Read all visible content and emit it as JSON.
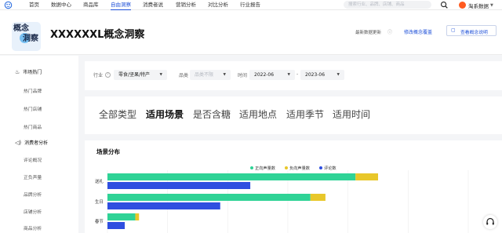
{
  "nav": {
    "items": [
      {
        "label": "首页",
        "active": false
      },
      {
        "label": "数据中心",
        "active": false
      },
      {
        "label": "商品库",
        "active": false
      },
      {
        "label": "自由洞察",
        "active": true
      },
      {
        "label": "消费者说",
        "active": false
      },
      {
        "label": "营销分析",
        "active": false
      },
      {
        "label": "对比分析",
        "active": false
      },
      {
        "label": "行业报告",
        "active": false
      }
    ],
    "search_placeholder": "搜索行业、品牌、店铺、商品",
    "brand": "淘系数据"
  },
  "header": {
    "logo_line1": "概念",
    "logo_line2": "洞察",
    "title": "XXXXXXL概念洞察",
    "update_label": "最新数据更新",
    "modify_label": "修改概念覆盖",
    "view_label": "查看概念说明"
  },
  "sidebar": {
    "sections": [
      {
        "title": "市场热门",
        "icon": "fire-icon",
        "items": [
          "热门品牌",
          "热门店铺",
          "热门商品"
        ]
      },
      {
        "title": "消费者分析",
        "icon": "speaker-icon",
        "items": [
          "评论概况",
          "正负声量",
          "品牌分析",
          "店铺分析",
          "商品分析"
        ]
      }
    ]
  },
  "filters": {
    "industry_label": "行业",
    "industry_value": "零食/坚果/特产",
    "category_label": "品类",
    "category_placeholder": "品类不限",
    "time_label": "时间",
    "time_start": "2022-06",
    "time_sep": "-",
    "time_end": "2023-06"
  },
  "tabs": [
    "全部类型",
    "适用场景",
    "是否含糖",
    "适用地点",
    "适用季节",
    "适用时间"
  ],
  "active_tab": "适用场景",
  "colors": {
    "positive": "#2fd396",
    "negative": "#e8c72a",
    "reviews": "#2f4fe0",
    "accent": "#1d4fd8"
  },
  "chart_data": {
    "type": "bar",
    "title": "场景分布",
    "stacked_orientation": "horizontal",
    "legend_position": "top-right",
    "grid": true,
    "categories": [
      "送礼",
      "生日",
      "春节"
    ],
    "series": [
      {
        "name": "正向声量数",
        "values": [
          1650,
          1350,
          185
        ]
      },
      {
        "name": "负向声量数",
        "values": [
          150,
          100,
          25
        ]
      },
      {
        "name": "评论数",
        "values": [
          950,
          750,
          115
        ]
      }
    ],
    "xlim": [
      0,
      2400
    ]
  }
}
